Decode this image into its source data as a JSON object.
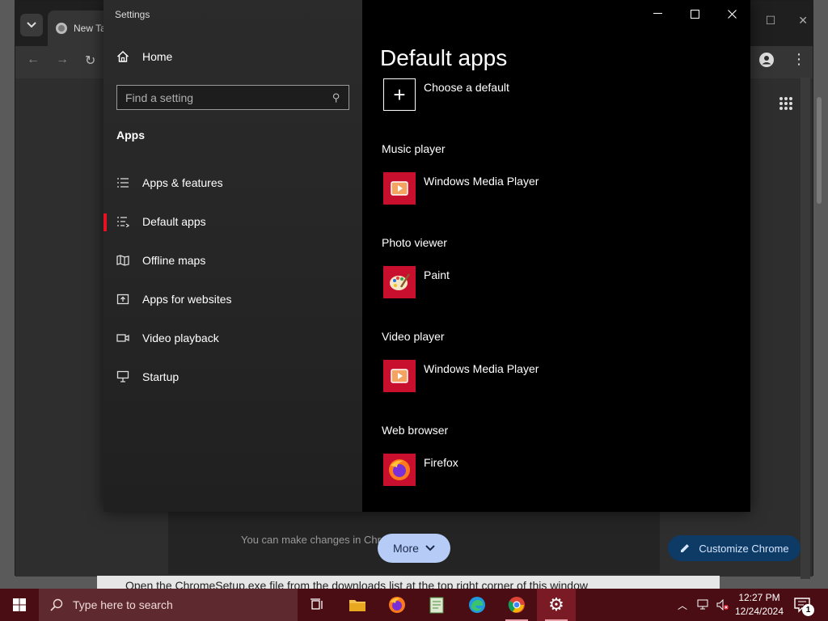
{
  "chrome": {
    "tab_label": "New Ta",
    "window_controls": [
      "restore-icon",
      "close-icon"
    ],
    "footer_text": "You can make changes in Chro",
    "more_label": "More",
    "customize_label": "Customize Chrome",
    "page_text": "Open the ChromeSetup.exe file from the downloads list at the top right corner of this window"
  },
  "settings": {
    "window_title": "Settings",
    "home_label": "Home",
    "search": {
      "placeholder": "Find a setting"
    },
    "section_heading": "Apps",
    "nav": [
      {
        "label": "Apps & features",
        "icon": "list-icon",
        "active": false
      },
      {
        "label": "Default apps",
        "icon": "default-apps-icon",
        "active": true
      },
      {
        "label": "Offline maps",
        "icon": "map-icon",
        "active": false
      },
      {
        "label": "Apps for websites",
        "icon": "link-box-icon",
        "active": false
      },
      {
        "label": "Video playback",
        "icon": "video-icon",
        "active": false
      },
      {
        "label": "Startup",
        "icon": "monitor-icon",
        "active": false
      }
    ],
    "accent_color": "#e81123",
    "main": {
      "title": "Default apps",
      "choose_default_label": "Choose a default",
      "groups": [
        {
          "label": "Music player",
          "app": "Windows Media Player",
          "icon": "media-player-icon"
        },
        {
          "label": "Photo viewer",
          "app": "Paint",
          "icon": "paint-icon"
        },
        {
          "label": "Video player",
          "app": "Windows Media Player",
          "icon": "media-player-icon"
        },
        {
          "label": "Web browser",
          "app": "Firefox",
          "icon": "firefox-icon"
        }
      ],
      "tile_color": "#c8102e"
    }
  },
  "taskbar": {
    "search_placeholder": "Type here to search",
    "time": "12:27 PM",
    "date": "12/24/2024",
    "notification_count": "1",
    "color": "#4a0d14"
  }
}
